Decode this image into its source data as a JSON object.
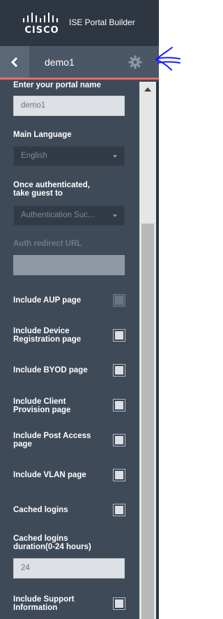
{
  "header": {
    "logo_text": "CISCO",
    "app_title": "ISE Portal Builder"
  },
  "nav": {
    "title": "demo1",
    "back_icon": "chevron-left-icon",
    "settings_icon": "gear-icon"
  },
  "form": {
    "portal_name_label": "Enter your portal name",
    "portal_name_value": "demo1",
    "main_language_label": "Main Language",
    "main_language_value": "English",
    "after_auth_label_line1": "Once authenticated,",
    "after_auth_label_line2": "take guest to",
    "after_auth_value": "Authentication Suc...",
    "auth_redirect_label": "Auth redirect URL",
    "auth_redirect_value": "",
    "aup_label": "Include AUP page",
    "device_reg_label_line1": "Include Device",
    "device_reg_label_line2": "Registration page",
    "byod_label": "Include BYOD page",
    "client_prov_label_line1": "Include Client",
    "client_prov_label_line2": "Provision page",
    "post_access_label_line1": "Include Post Access",
    "post_access_label_line2": "page",
    "vlan_label": "Include VLAN page",
    "cached_logins_label": "Cached logins",
    "cached_duration_label_line1": "Cached logins",
    "cached_duration_label_line2": "duration(0-24 hours)",
    "cached_duration_value": "24",
    "support_info_label_line1": "Include Support",
    "support_info_label_line2": "Information"
  },
  "colors": {
    "panel": "#3f4a59",
    "header": "#2e3641",
    "accent_line": "#e86b6b",
    "annotation": "#1a1aff"
  }
}
